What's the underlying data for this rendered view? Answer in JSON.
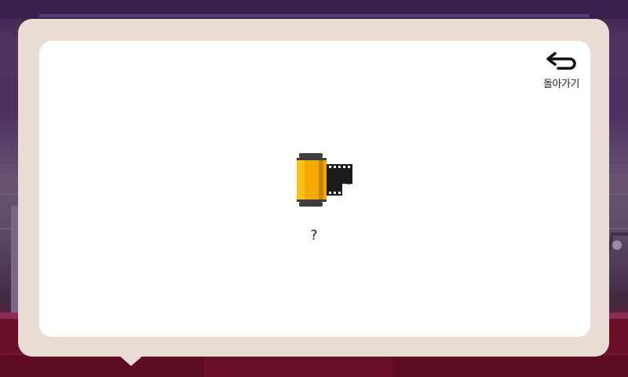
{
  "header": {
    "back_label": "돌아가기",
    "back_icon": "return-arrow-icon"
  },
  "item": {
    "icon": "film-roll-icon",
    "name": "?"
  },
  "colors": {
    "dialog_frame": "#e8dcd4",
    "dialog_body": "#ffffff",
    "film_canister": "#f5a800",
    "film_strip": "#1a1a1a"
  }
}
